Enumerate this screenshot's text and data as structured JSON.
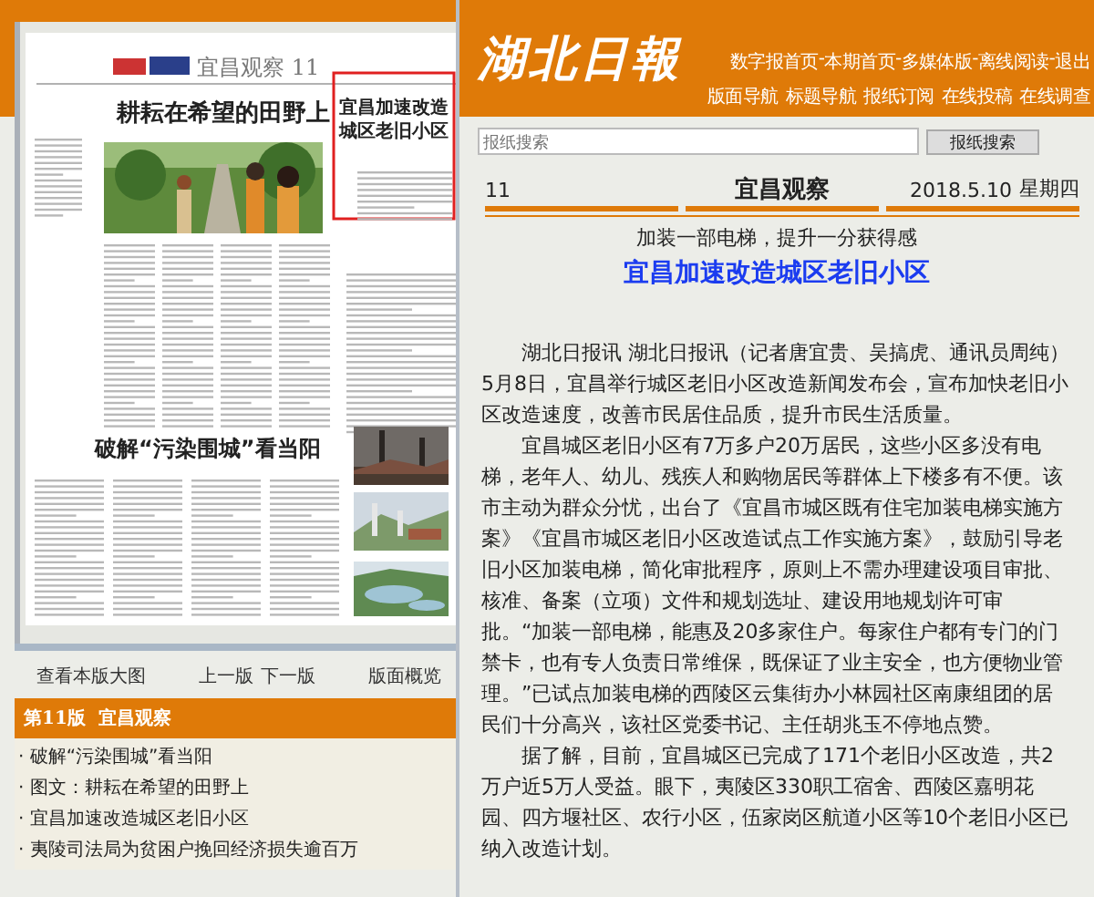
{
  "newspaper_page": {
    "section_title": "宜昌观察 11",
    "headline": "耕耘在希望的田野上",
    "highlight_headline": [
      "宜昌加速改造",
      "城区老旧小区"
    ],
    "second_headline": "破解“污染围城”看当阳"
  },
  "page_nav": {
    "view_large": "查看本版大图",
    "prev": "上一版",
    "next": "下一版",
    "overview": "版面概览"
  },
  "section_bar": "第11版  宜昌观察",
  "article_list": [
    "· 破解“污染围城”看当阳",
    "· 图文：耕耘在希望的田野上",
    "· 宜昌加速改造城区老旧小区",
    "· 夷陵司法局为贫困户挽回经济损失逾百万"
  ],
  "header": {
    "logo": "湖北日報",
    "top_links": [
      "数字报首页",
      "本期首页",
      "多媒体版",
      "离线阅读",
      "退出"
    ],
    "separator": "-",
    "nav_links": [
      "版面导航",
      "标题导航",
      "报纸订阅",
      "在线投稿",
      "在线调查"
    ]
  },
  "search": {
    "placeholder": "报纸搜索",
    "button": "报纸搜索"
  },
  "page_header": {
    "page_number": "11",
    "section": "宜昌观察",
    "date": "2018.5.10",
    "weekday": "星期四"
  },
  "article": {
    "subtitle": "加装一部电梯，提升一分获得感",
    "title": "宜昌加速改造城区老旧小区",
    "paragraphs": [
      "湖北日报讯 湖北日报讯（记者唐宜贵、吴搞虎、通讯员周纯）5月8日，宜昌举行城区老旧小区改造新闻发布会，宣布加快老旧小区改造速度，改善市民居住品质，提升市民生活质量。",
      "宜昌城区老旧小区有7万多户20万居民，这些小区多没有电梯，老年人、幼儿、残疾人和购物居民等群体上下楼多有不便。该市主动为群众分忧，出台了《宜昌市城区既有住宅加装电梯实施方案》《宜昌市城区老旧小区改造试点工作实施方案》，鼓励引导老旧小区加装电梯，简化审批程序，原则上不需办理建设项目审批、核准、备案（立项）文件和规划选址、建设用地规划许可审批。“加装一部电梯，能惠及20多家住户。每家住户都有专门的门禁卡，也有专人负责日常维保，既保证了业主安全，也方便物业管理。”已试点加装电梯的西陵区云集街办小林园社区南康组团的居民们十分高兴，该社区党委书记、主任胡兆玉不停地点赞。",
      "据了解，目前，宜昌城区已完成了171个老旧小区改造，共2万户近5万人受益。眼下，夷陵区330职工宿舍、西陵区嘉明花园、四方堰社区、农行小区，伍家岗区航道小区等10个老旧小区已纳入改造计划。"
    ]
  }
}
